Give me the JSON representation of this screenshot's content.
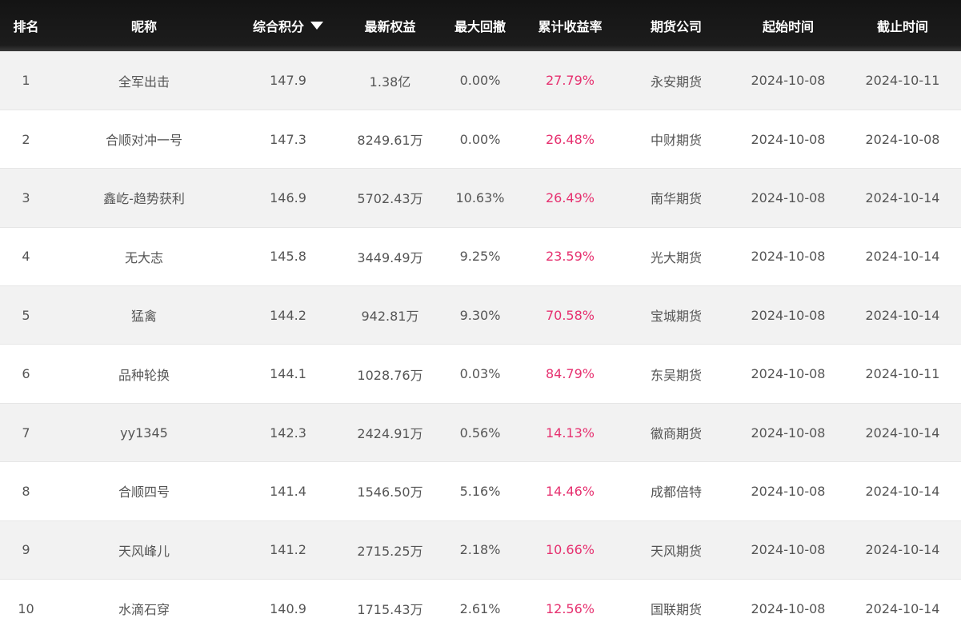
{
  "headers": {
    "rank": "排名",
    "nickname": "昵称",
    "score": "综合积分",
    "equity": "最新权益",
    "drawdown": "最大回撤",
    "return_rate": "累计收益率",
    "broker": "期货公司",
    "start": "起始时间",
    "end": "截止时间"
  },
  "sort": {
    "column": "score",
    "direction": "desc",
    "icon": "sort-desc-caret-icon"
  },
  "colors": {
    "header_bg": "#141414",
    "header_text": "#ffffff",
    "row_alt_bg": "#f2f2f2",
    "text": "#555555",
    "return_rate": "#e6306f"
  },
  "rows": [
    {
      "rank": "1",
      "nickname": "全军出击",
      "score": "147.9",
      "equity": "1.38亿",
      "drawdown": "0.00%",
      "return_rate": "27.79%",
      "broker": "永安期货",
      "start": "2024-10-08",
      "end": "2024-10-11"
    },
    {
      "rank": "2",
      "nickname": "合顺对冲一号",
      "score": "147.3",
      "equity": "8249.61万",
      "drawdown": "0.00%",
      "return_rate": "26.48%",
      "broker": "中财期货",
      "start": "2024-10-08",
      "end": "2024-10-08"
    },
    {
      "rank": "3",
      "nickname": "鑫屹-趋势获利",
      "score": "146.9",
      "equity": "5702.43万",
      "drawdown": "10.63%",
      "return_rate": "26.49%",
      "broker": "南华期货",
      "start": "2024-10-08",
      "end": "2024-10-14"
    },
    {
      "rank": "4",
      "nickname": "无大志",
      "score": "145.8",
      "equity": "3449.49万",
      "drawdown": "9.25%",
      "return_rate": "23.59%",
      "broker": "光大期货",
      "start": "2024-10-08",
      "end": "2024-10-14"
    },
    {
      "rank": "5",
      "nickname": "猛禽",
      "score": "144.2",
      "equity": "942.81万",
      "drawdown": "9.30%",
      "return_rate": "70.58%",
      "broker": "宝城期货",
      "start": "2024-10-08",
      "end": "2024-10-14"
    },
    {
      "rank": "6",
      "nickname": "品种轮换",
      "score": "144.1",
      "equity": "1028.76万",
      "drawdown": "0.03%",
      "return_rate": "84.79%",
      "broker": "东吴期货",
      "start": "2024-10-08",
      "end": "2024-10-11"
    },
    {
      "rank": "7",
      "nickname": "yy1345",
      "score": "142.3",
      "equity": "2424.91万",
      "drawdown": "0.56%",
      "return_rate": "14.13%",
      "broker": "徽商期货",
      "start": "2024-10-08",
      "end": "2024-10-14"
    },
    {
      "rank": "8",
      "nickname": "合顺四号",
      "score": "141.4",
      "equity": "1546.50万",
      "drawdown": "5.16%",
      "return_rate": "14.46%",
      "broker": "成都倍特",
      "start": "2024-10-08",
      "end": "2024-10-14"
    },
    {
      "rank": "9",
      "nickname": "天风峰儿",
      "score": "141.2",
      "equity": "2715.25万",
      "drawdown": "2.18%",
      "return_rate": "10.66%",
      "broker": "天风期货",
      "start": "2024-10-08",
      "end": "2024-10-14"
    },
    {
      "rank": "10",
      "nickname": "水滴石穿",
      "score": "140.9",
      "equity": "1715.43万",
      "drawdown": "2.61%",
      "return_rate": "12.56%",
      "broker": "国联期货",
      "start": "2024-10-08",
      "end": "2024-10-14"
    }
  ]
}
